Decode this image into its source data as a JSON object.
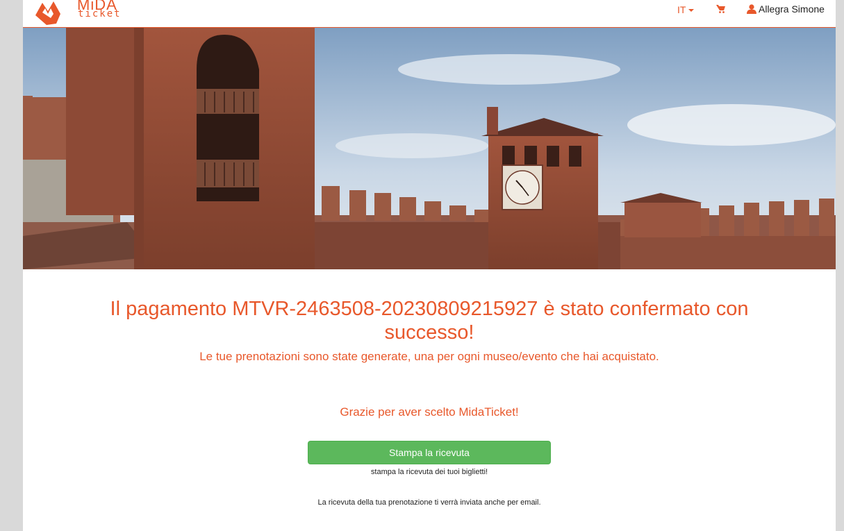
{
  "brand": {
    "logo_top": "MiDA",
    "logo_bottom": "ticket",
    "accent": "#e8582b",
    "button_green": "#5cb85c"
  },
  "nav": {
    "language": "IT",
    "cart_icon": "shopping-cart-icon",
    "user_icon": "user-icon",
    "user_name": "Allegra Simone"
  },
  "main": {
    "title": "Il pagamento MTVR-2463508-20230809215927 è stato confermato con successo!",
    "subtitle": "Le tue prenotazioni sono state generate, una per ogni museo/evento che hai acquistato.",
    "thanks": "Grazie per aver scelto MidaTicket!",
    "print_button": "Stampa la ricevuta",
    "print_hint": "stampa la ricevuta dei tuoi biglietti!",
    "email_note": "La ricevuta della tua prenotazione ti verrà inviata anche per email."
  }
}
